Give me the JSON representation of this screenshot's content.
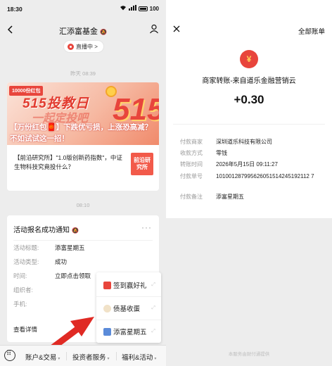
{
  "status_bar": {
    "time": "18:30",
    "battery": "100"
  },
  "chat": {
    "title": "汇添富基金",
    "live_label": "直播中 >",
    "timestamp_1": "昨天 08:39",
    "timestamp_2": "08:10",
    "article": {
      "tag": "10000份红包",
      "banner_text": "515投教日",
      "banner_text_2": "一起定投吧",
      "banner_number": "515",
      "caption": "【万份红包🧧】下跌优亏损，上涨恐高减？不如试试这一招！",
      "sub_title": "【前沿研究所】\"1.0版创新药指数\"，中证生物科技究竟投什么？",
      "thumb_label": "前沿研究所"
    },
    "notice": {
      "title": "活动报名成功通知",
      "more": "···",
      "rows": [
        {
          "label": "活动标题:",
          "value": "添富星期五"
        },
        {
          "label": "活动类型:",
          "value": "成功"
        },
        {
          "label": "时间:",
          "value": "立即点击领取"
        },
        {
          "label": "组织者:",
          "value": ""
        },
        {
          "label": "手机:",
          "value": ""
        }
      ],
      "detail": "查看详情"
    },
    "popup_menu": [
      {
        "label": "签到赢好礼",
        "icon": "gift-icon",
        "color": "#e8453c"
      },
      {
        "label": "债基收蛋",
        "icon": "egg-icon",
        "color": "#f1e2c8"
      },
      {
        "label": "添富星期五",
        "icon": "calendar-icon",
        "color": "#5b8bd9"
      }
    ],
    "bottom_menu": [
      {
        "label": "账户&交易"
      },
      {
        "label": "投资者服务"
      },
      {
        "label": "福利&活动"
      }
    ]
  },
  "receipt": {
    "all_bills": "全部账单",
    "merchant": "商家转账-来自道乐金融营销云",
    "amount": "+0.30",
    "rows": [
      {
        "label": "付款商家",
        "value": "深圳道乐科技有限公司"
      },
      {
        "label": "收款方式",
        "value": "零钱"
      },
      {
        "label": "转账时间",
        "value": "2026年5月15日 09:11:27"
      },
      {
        "label": "付款单号",
        "value": "101001287995626051514245192112 7"
      },
      {
        "label": "付款备注",
        "value": "添富星期五"
      }
    ],
    "footer": "本服务由财付通提供"
  },
  "colors": {
    "accent_red": "#e8453c",
    "bg": "#ededed"
  }
}
